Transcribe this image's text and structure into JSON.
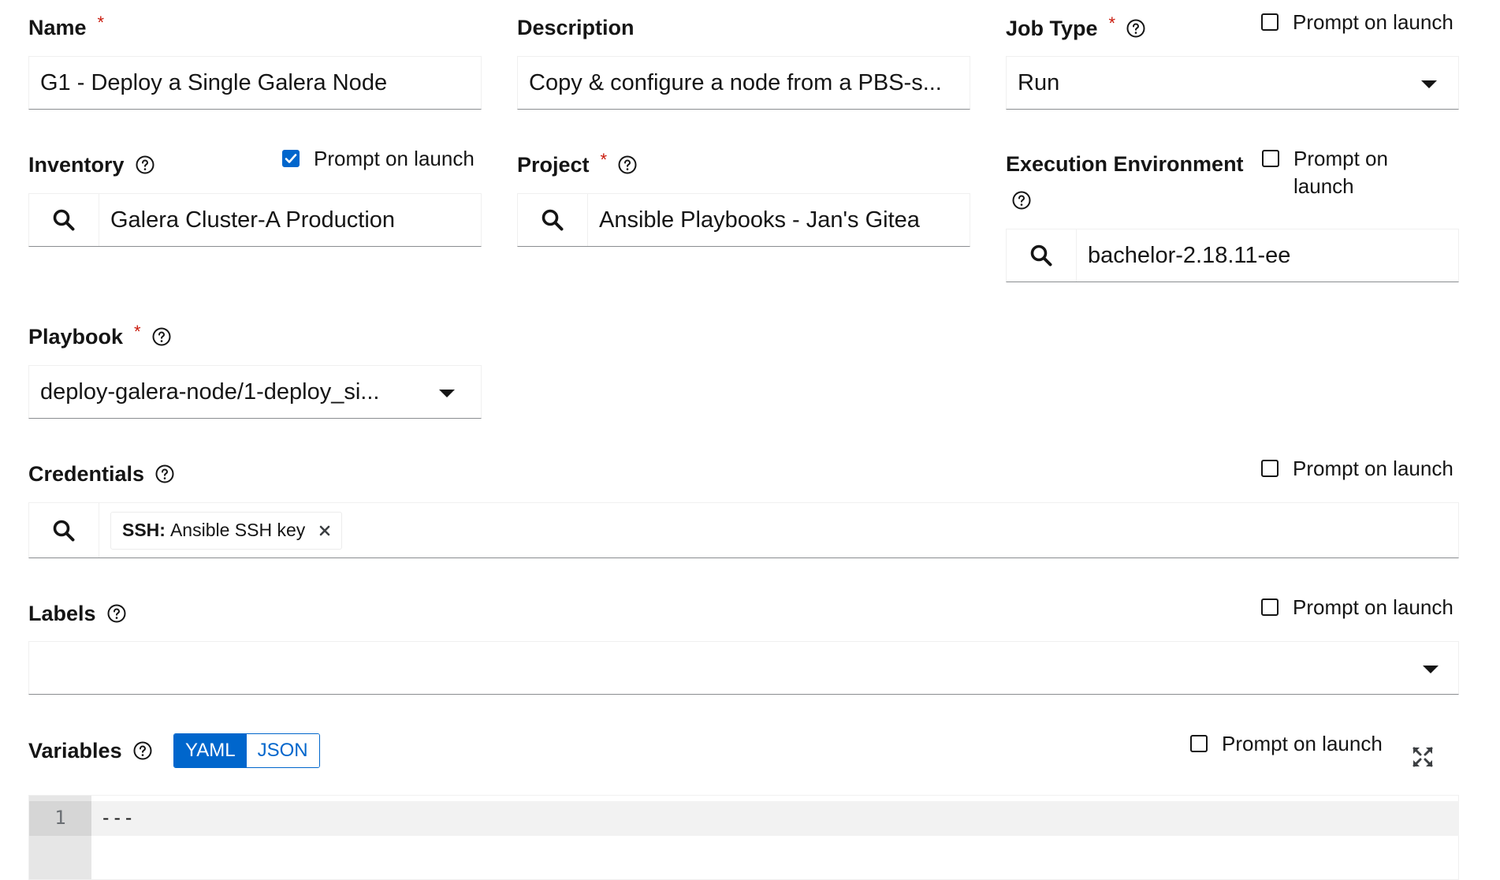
{
  "name": {
    "label": "Name",
    "value": "G1 - Deploy a Single Galera Node"
  },
  "description": {
    "label": "Description",
    "value": "Copy & configure a node from a PBS-s..."
  },
  "job_type": {
    "label": "Job Type",
    "prompt_label": "Prompt on launch",
    "value": "Run"
  },
  "inventory": {
    "label": "Inventory",
    "prompt_label": "Prompt on launch",
    "value": "Galera Cluster-A Production"
  },
  "project": {
    "label": "Project",
    "value": "Ansible Playbooks - Jan's Gitea"
  },
  "execution_environment": {
    "label": "Execution Environment",
    "prompt_label_line1": "Prompt on",
    "prompt_label_line2": "launch",
    "value": "bachelor-2.18.11-ee"
  },
  "playbook": {
    "label": "Playbook",
    "value": "deploy-galera-node/1-deploy_si..."
  },
  "credentials": {
    "label": "Credentials",
    "prompt_label": "Prompt on launch",
    "chip_type": "SSH:",
    "chip_name": "Ansible SSH key"
  },
  "labels": {
    "label": "Labels",
    "prompt_label": "Prompt on launch"
  },
  "variables": {
    "label": "Variables",
    "yaml": "YAML",
    "json": "JSON",
    "prompt_label": "Prompt on launch",
    "line_number": "1",
    "content": "---"
  },
  "required_marker": "*",
  "icons": {
    "help": "help-circle-icon",
    "search": "search-icon",
    "caret": "caret-down-icon",
    "close": "close-icon",
    "expand": "expand-icon",
    "check": "check-icon"
  },
  "colors": {
    "primary": "#0066cc",
    "required": "#c9190b",
    "border": "#8a8d90"
  }
}
